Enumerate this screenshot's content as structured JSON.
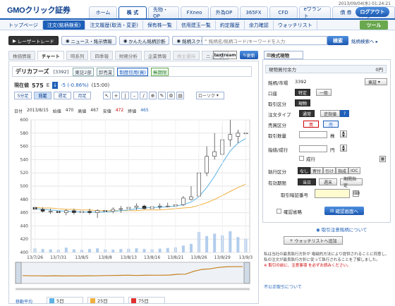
{
  "header": {
    "logo": "GMOクリック証券",
    "datetime": "2013/09/04(水) 01:24:21",
    "logout": "ログアウト",
    "nav": [
      "ホーム",
      "株 式",
      "先物・OP",
      "FXneo",
      "外為OP",
      "365FX",
      "CFD",
      "eワラント",
      "債 券",
      "マイページ"
    ]
  },
  "subnav": {
    "items": [
      "トップページ",
      "注文(銘柄検索)",
      "注文履歴(取消・変更)",
      "保有株一覧",
      "信用建玉一覧",
      "約定履歴",
      "余力確認",
      "ウォッチリスト"
    ],
    "tool_button": "ツール"
  },
  "tools": {
    "items": [
      "レーザートレード",
      "ニュース・銘示情報",
      "かんたん銘柄診断",
      "銘柄スクリーニング"
    ],
    "search_placeholder": "銘柄名/銘柄コード/キーワードを入力",
    "search_button": "検索",
    "search_menu": "銘柄検索へ ▸"
  },
  "info_tabs": [
    "株価情報",
    "チャート",
    "時系列",
    "四季報",
    "財務分析",
    "企業情報",
    "株主優待",
    "ニュース"
  ],
  "textream": "textream",
  "refresh": "更新",
  "stock": {
    "name": "デリカフーズ",
    "code": "[3392]",
    "tags": [
      "東証2部",
      "卸売業",
      "制度信用(買)",
      "無期限"
    ],
    "price_label": "現在値",
    "price": "575",
    "price_unit": "E",
    "change": "-5 (-0.86%)",
    "time": "(15:00)"
  },
  "period_buttons": [
    "5分足",
    "日足",
    "週足",
    "月足"
  ],
  "chart_type_select": "ローソク",
  "ohlc": {
    "date_label": "日付",
    "date": "2013/8/15",
    "open_label": "始値",
    "open": "470",
    "high_label": "高値",
    "high": "467",
    "low_label": "安値",
    "low": "472",
    "close_label": "終値",
    "close": "465"
  },
  "chart_data": {
    "type": "candlestick",
    "categories": [
      "13/7/26",
      "13/7/29",
      "13/7/30",
      "13/7/31",
      "13/8/1",
      "13/8/2",
      "13/8/5",
      "13/8/6",
      "13/8/7",
      "13/8/8",
      "13/8/9",
      "13/8/12",
      "13/8/13",
      "13/8/14",
      "13/8/15",
      "13/8/16",
      "13/8/19",
      "13/8/20",
      "13/8/21",
      "13/8/22",
      "13/8/23",
      "13/8/26",
      "13/8/27",
      "13/8/28",
      "13/8/29",
      "13/8/30",
      "13/9/2",
      "13/9/3"
    ],
    "x_tick_labels": [
      "13/7/26",
      "13/7/31",
      "13/8/5",
      "13/8/8",
      "13/8/13",
      "13/8/16",
      "13/8/21",
      "13/8/26",
      "13/8/29",
      "13/9/3"
    ],
    "open": [
      468,
      465,
      462,
      462,
      460,
      463,
      460,
      462,
      460,
      463,
      462,
      465,
      466,
      468,
      470,
      466,
      469,
      470,
      470,
      472,
      480,
      485,
      520,
      545,
      548,
      570,
      575,
      580
    ],
    "high": [
      470,
      468,
      466,
      465,
      465,
      466,
      465,
      466,
      465,
      468,
      468,
      470,
      472,
      474,
      472,
      472,
      474,
      475,
      478,
      485,
      500,
      550,
      560,
      580,
      590,
      600,
      585,
      588
    ],
    "low": [
      462,
      460,
      458,
      458,
      456,
      457,
      455,
      457,
      452,
      458,
      459,
      460,
      462,
      464,
      465,
      462,
      465,
      468,
      466,
      470,
      478,
      483,
      515,
      540,
      545,
      560,
      565,
      570
    ],
    "close": [
      465,
      462,
      462,
      460,
      463,
      460,
      462,
      460,
      463,
      462,
      465,
      466,
      468,
      470,
      466,
      469,
      470,
      470,
      472,
      482,
      484,
      520,
      545,
      552,
      570,
      578,
      580,
      580
    ],
    "ma5": [
      466,
      465,
      464,
      463,
      462,
      462,
      461,
      461,
      461,
      461,
      462,
      463,
      464,
      466,
      467,
      468,
      468,
      469,
      470,
      472,
      476,
      484,
      498,
      515,
      535,
      553,
      565,
      572
    ],
    "ma25": [
      468,
      467,
      467,
      466,
      465,
      465,
      464,
      464,
      463,
      463,
      463,
      463,
      463,
      463,
      464,
      464,
      464,
      465,
      466,
      467,
      468,
      471,
      475,
      480,
      486,
      492,
      498,
      503
    ],
    "volume": [
      12,
      10,
      9,
      8,
      14,
      9,
      8,
      10,
      12,
      9,
      8,
      10,
      11,
      12,
      10,
      9,
      11,
      13,
      15,
      20,
      25,
      60,
      48,
      55,
      50,
      62,
      45,
      40
    ],
    "ylim": [
      400,
      600
    ],
    "y_ticks": [
      400,
      420,
      440,
      460,
      480,
      500,
      520,
      540,
      560,
      580,
      600
    ],
    "legend": [
      "5日",
      "25日",
      "75日"
    ],
    "colors": {
      "ma5": "#5db3e6",
      "ma25": "#f0b040",
      "ma75": "#e03030",
      "candle": "#333333",
      "volume": "#9fc0e8",
      "overview": "#c87f1c"
    }
  },
  "ma_legend_label": "移動平均",
  "right_panel": {
    "tab": "株式現物",
    "capacity_label": "現物買付余力",
    "capacity_value": "0円",
    "symbol_label": "銘柄/市場",
    "symbol_value": "3392",
    "market": "東証",
    "account_label": "口座",
    "account_options": [
      "特定",
      "一般"
    ],
    "trade_label": "取引区分",
    "trade_value": "現物",
    "order_type_label": "注文タイプ",
    "order_types": [
      "通常",
      "逆指値"
    ],
    "side_label": "売買区分",
    "side_buy": "買",
    "side_sell": "売",
    "qty_label": "取引数量",
    "qty_unit": "株",
    "price_label": "指値/成行",
    "price_unit": "円",
    "market_order_label": "成行",
    "exec_label": "執行区分",
    "exec_options": [
      "なし",
      "寄付",
      "引け",
      "指成",
      "IOC"
    ],
    "period_label": "有効期限",
    "period_options": [
      "当日",
      "週末",
      "期間指定"
    ],
    "pin_label": "取引暗証番号",
    "skip_confirm_label": "確認省略",
    "confirm_button": "確認画面へ",
    "link": "取引注意銘柄について",
    "watchlist_button": "ウォッチリストへ追加",
    "notice": "私は当社の最良執行方針が 電磁的方法により提供されることに同意し、私の注文が最良執行方針に従って執行されることを了解しました。",
    "notice_link_text": "注意事項",
    "notice_tail": "※ 取引の前に、注意事項 を必ずお読みください。",
    "unfair_link": "不公正取引について"
  }
}
